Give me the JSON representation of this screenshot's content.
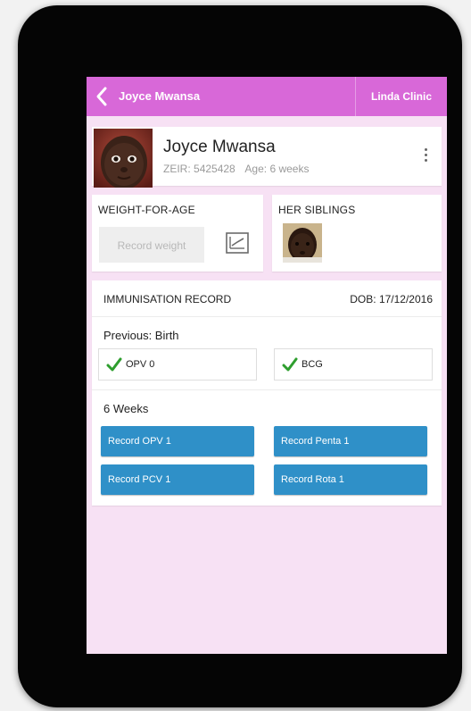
{
  "topbar": {
    "title": "Joyce Mwansa",
    "clinic": "Linda Clinic"
  },
  "profile": {
    "name": "Joyce Mwansa",
    "zeir_label": "ZEIR:",
    "zeir": "5425428",
    "age_label": "Age:",
    "age": "6 weeks"
  },
  "weight": {
    "title": "WEIGHT-FOR-AGE",
    "record_label": "Record weight"
  },
  "siblings": {
    "title": "HER SIBLINGS"
  },
  "immunisation": {
    "title": "IMMUNISATION RECORD",
    "dob": "DOB: 17/12/2016",
    "previous": {
      "label": "Previous: Birth",
      "given": [
        {
          "label": "OPV 0"
        },
        {
          "label": "BCG"
        }
      ]
    },
    "due": {
      "label": "6 Weeks",
      "buttons": [
        {
          "label": "Record OPV 1"
        },
        {
          "label": "Record Penta 1"
        },
        {
          "label": "Record PCV 1"
        },
        {
          "label": "Record Rota 1"
        }
      ]
    }
  },
  "colors": {
    "topbar": "#d868d8",
    "background": "#f7e1f4",
    "record_button": "#2f90c8",
    "check": "#2e9e2e"
  }
}
